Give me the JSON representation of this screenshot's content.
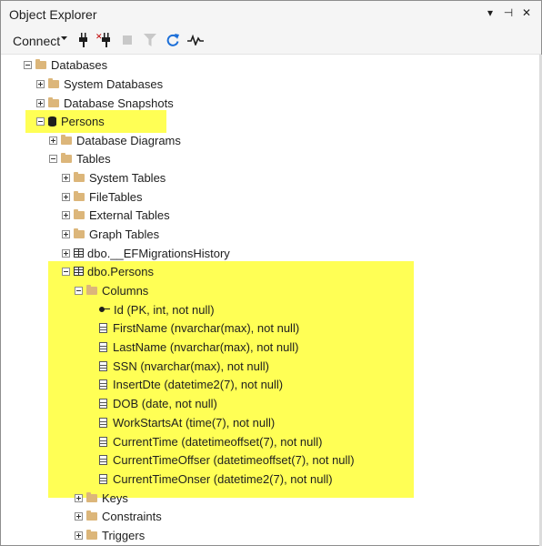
{
  "window": {
    "title": "Object Explorer",
    "pin_icon": "pin-icon",
    "menu_icon": "dropdown-arrow-icon"
  },
  "toolbar": {
    "connect_label": "Connect",
    "icons": [
      "connect-icon",
      "disconnect-icon",
      "stop-icon",
      "filter-icon",
      "refresh-icon",
      "activity-monitor-icon"
    ]
  },
  "highlight_color": "#ffff55",
  "tree": {
    "databases": "Databases",
    "system_databases": "System Databases",
    "database_snapshots": "Database Snapshots",
    "persons_db": "Persons",
    "database_diagrams": "Database Diagrams",
    "tables": "Tables",
    "system_tables": "System Tables",
    "file_tables": "FileTables",
    "external_tables": "External Tables",
    "graph_tables": "Graph Tables",
    "ef_history": "dbo.__EFMigrationsHistory",
    "dbo_persons": "dbo.Persons",
    "columns": "Columns",
    "column_items": [
      "Id (PK, int, not null)",
      "FirstName (nvarchar(max), not null)",
      "LastName (nvarchar(max), not null)",
      "SSN (nvarchar(max), not null)",
      "InsertDte (datetime2(7), not null)",
      "DOB (date, not null)",
      "WorkStartsAt (time(7), not null)",
      "CurrentTime (datetimeoffset(7), not null)",
      "CurrentTimeOffser (datetimeoffset(7), not null)",
      "CurrentTimeOnser (datetime2(7), not null)"
    ],
    "keys": "Keys",
    "constraints": "Constraints",
    "triggers": "Triggers"
  }
}
